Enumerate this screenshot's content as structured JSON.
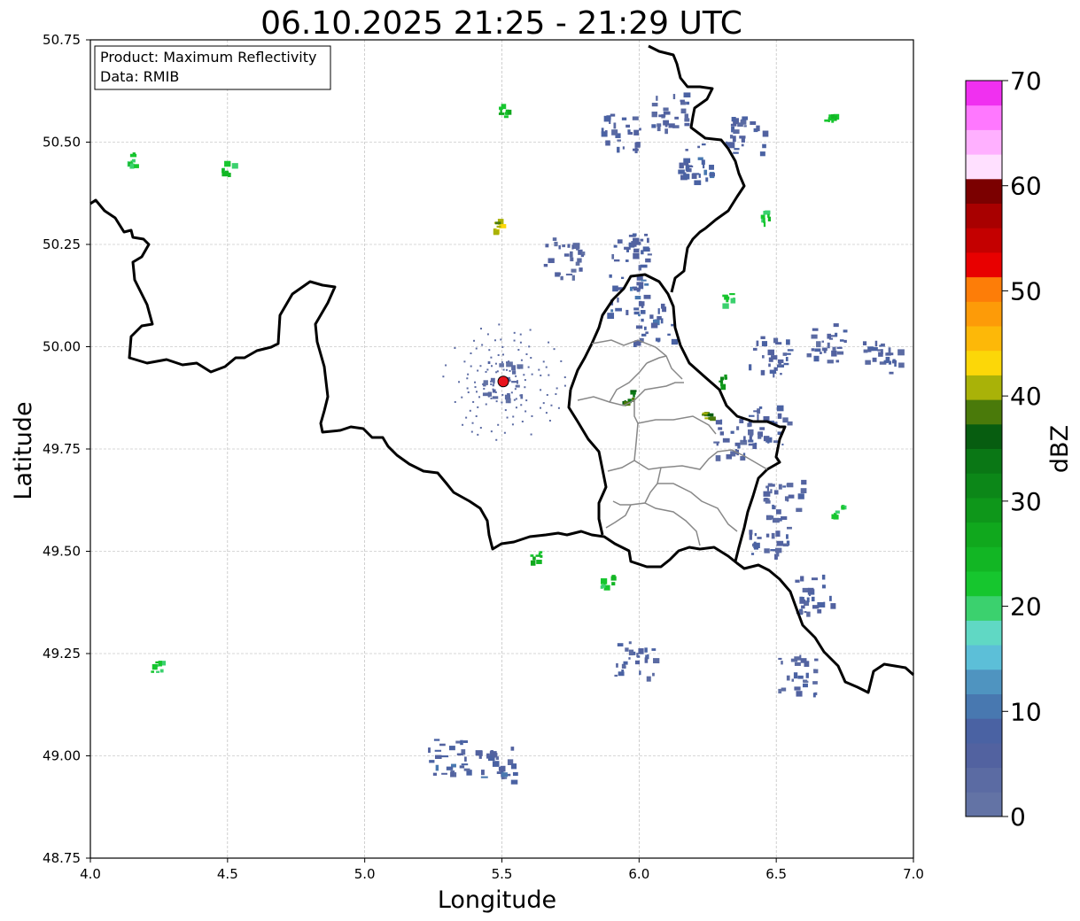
{
  "title": "06.10.2025 21:25 - 21:29 UTC",
  "info_box": {
    "product_line": "Product: Maximum Reflectivity",
    "data_line": "Data: RMIB"
  },
  "axes": {
    "xlabel": "Longitude",
    "ylabel": "Latitude",
    "xlim": [
      4.0,
      7.0
    ],
    "ylim": [
      48.75,
      50.75
    ],
    "xticks": [
      4.0,
      4.5,
      5.0,
      5.5,
      6.0,
      6.5,
      7.0
    ],
    "yticks": [
      48.75,
      49.0,
      49.25,
      49.5,
      49.75,
      50.0,
      50.25,
      50.5,
      50.75
    ],
    "xtick_labels": [
      "4.0",
      "4.5",
      "5.0",
      "5.5",
      "6.0",
      "6.5",
      "7.0"
    ],
    "ytick_labels": [
      "48.75",
      "49.00",
      "49.25",
      "49.50",
      "49.75",
      "50.00",
      "50.25",
      "50.50",
      "50.75"
    ],
    "grid": true
  },
  "colorbar": {
    "label": "dBZ",
    "min": 0,
    "max": 70,
    "ticks": [
      0,
      10,
      20,
      30,
      40,
      50,
      60,
      70
    ],
    "tick_labels": [
      "0",
      "10",
      "20",
      "30",
      "40",
      "50",
      "60",
      "70"
    ],
    "colors": [
      "#6373a5",
      "#5b6ba3",
      "#5262a0",
      "#4a62a3",
      "#4878b0",
      "#4f94c0",
      "#5cbfd8",
      "#60d8c4",
      "#3bd16e",
      "#16c62e",
      "#12b624",
      "#10a81d",
      "#0e971a",
      "#0c8718",
      "#0a7715",
      "#075d10",
      "#4a7a0a",
      "#a9b208",
      "#fcd708",
      "#fdb808",
      "#fd9b08",
      "#fd7d08",
      "#e80000",
      "#c40000",
      "#a80000",
      "#7b0000",
      "#ffe0ff",
      "#ffb0ff",
      "#ff78ff",
      "#f030f0"
    ]
  },
  "radar_site": {
    "lon": 5.505,
    "lat": 49.915,
    "color": "#e8141c"
  },
  "chart_data": {
    "type": "map",
    "title": "06.10.2025 21:25 - 21:29 UTC",
    "product": "Maximum Reflectivity",
    "source": "RMIB",
    "value_unit": "dBZ",
    "xlabel": "Longitude",
    "ylabel": "Latitude",
    "xlim": [
      4.0,
      7.0
    ],
    "ylim": [
      48.75,
      50.75
    ],
    "echo_clusters": [
      {
        "lon": 5.93,
        "lat": 50.53,
        "dbz": 6
      },
      {
        "lon": 6.2,
        "lat": 50.45,
        "dbz": 7
      },
      {
        "lon": 6.38,
        "lat": 50.52,
        "dbz": 6
      },
      {
        "lon": 6.11,
        "lat": 50.58,
        "dbz": 5
      },
      {
        "lon": 5.97,
        "lat": 50.24,
        "dbz": 6
      },
      {
        "lon": 5.95,
        "lat": 50.13,
        "dbz": 8
      },
      {
        "lon": 6.05,
        "lat": 50.06,
        "dbz": 7
      },
      {
        "lon": 5.72,
        "lat": 50.22,
        "dbz": 4
      },
      {
        "lon": 6.47,
        "lat": 49.98,
        "dbz": 6
      },
      {
        "lon": 6.68,
        "lat": 50.01,
        "dbz": 5
      },
      {
        "lon": 6.88,
        "lat": 49.98,
        "dbz": 5
      },
      {
        "lon": 6.47,
        "lat": 49.81,
        "dbz": 6
      },
      {
        "lon": 6.33,
        "lat": 49.78,
        "dbz": 5
      },
      {
        "lon": 6.52,
        "lat": 49.63,
        "dbz": 5
      },
      {
        "lon": 6.47,
        "lat": 49.54,
        "dbz": 6
      },
      {
        "lon": 6.63,
        "lat": 49.4,
        "dbz": 6
      },
      {
        "lon": 6.57,
        "lat": 49.2,
        "dbz": 5
      },
      {
        "lon": 5.3,
        "lat": 49.0,
        "dbz": 7
      },
      {
        "lon": 5.47,
        "lat": 48.98,
        "dbz": 7
      },
      {
        "lon": 5.98,
        "lat": 49.24,
        "dbz": 6
      },
      {
        "lon": 5.5,
        "lat": 49.92,
        "dbz": 3
      },
      {
        "lon": 5.88,
        "lat": 49.43,
        "dbz": 22
      },
      {
        "lon": 5.62,
        "lat": 49.49,
        "dbz": 24
      },
      {
        "lon": 6.32,
        "lat": 50.12,
        "dbz": 22
      },
      {
        "lon": 6.46,
        "lat": 50.32,
        "dbz": 22
      },
      {
        "lon": 6.72,
        "lat": 49.6,
        "dbz": 21
      },
      {
        "lon": 6.25,
        "lat": 49.84,
        "dbz": 38
      },
      {
        "lon": 5.96,
        "lat": 49.88,
        "dbz": 36
      },
      {
        "lon": 6.31,
        "lat": 49.92,
        "dbz": 30
      },
      {
        "lon": 4.24,
        "lat": 49.22,
        "dbz": 22
      },
      {
        "lon": 4.14,
        "lat": 50.46,
        "dbz": 22
      },
      {
        "lon": 4.5,
        "lat": 50.44,
        "dbz": 22
      },
      {
        "lon": 6.69,
        "lat": 50.56,
        "dbz": 23
      },
      {
        "lon": 5.5,
        "lat": 50.58,
        "dbz": 24
      },
      {
        "lon": 5.47,
        "lat": 50.3,
        "dbz": 41
      }
    ]
  }
}
